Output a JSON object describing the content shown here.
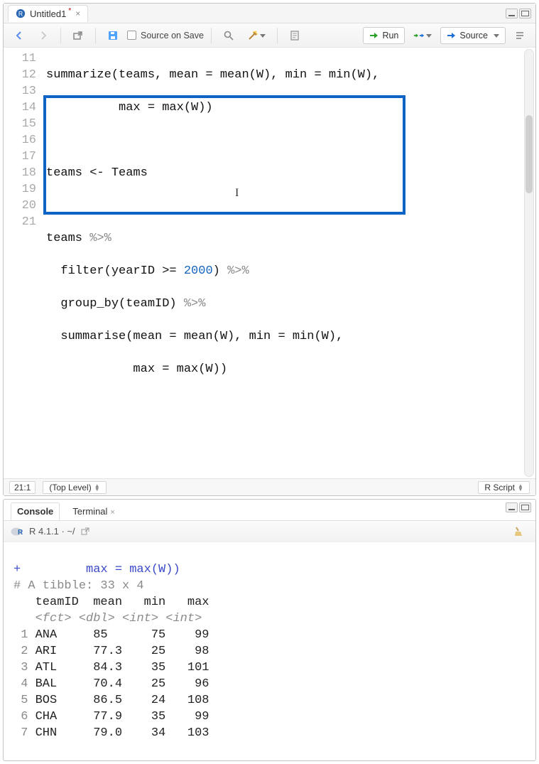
{
  "editor_tab": {
    "icon": "r-doc-icon",
    "title": "Untitled1",
    "dirty": "*"
  },
  "toolbar": {
    "source_on_save": "Source on Save",
    "run": "Run",
    "source": "Source"
  },
  "gutter": [
    "11",
    "12",
    "13",
    "14",
    "15",
    "16",
    "17",
    "18",
    "19",
    "20",
    "21"
  ],
  "code": {
    "l11a": "summarize(teams, mean = mean(W), min = min(W),",
    "l12a": "          max = max(W))",
    "l13a": "",
    "l14a": "teams <- Teams",
    "l15a": "",
    "l16a": "teams ",
    "l16b": "%>%",
    "l17a": "  filter(yearID >= ",
    "l17n": "2000",
    "l17b": ") ",
    "l17c": "%>%",
    "l18a": "  group_by(teamID) ",
    "l18b": "%>%",
    "l19a": "  summarise(mean = mean(W), min = min(W),",
    "l20a": "            max = max(W))",
    "l21a": ""
  },
  "status": {
    "pos": "21:1",
    "scope": "(Top Level)",
    "lang": "R Script"
  },
  "console": {
    "tabs": {
      "console": "Console",
      "terminal": "Terminal"
    },
    "rver": "R 4.1.1 · ~/",
    "plus": "+",
    "cont": "         max = max(W))",
    "tibble": "# A tibble: 33 x 4",
    "hdr_teamID": "   teamID",
    "hdr_mean": "  mean",
    "hdr_min": "   min",
    "hdr_max": "   max",
    "typ_fct": "   <fct>",
    "typ_dbl": " <dbl>",
    "typ_int1": " <int>",
    "typ_int2": " <int>",
    "rows": [
      {
        "n": "1",
        "team": "ANA",
        "mean": "85  ",
        "min": "75",
        "max": " 99"
      },
      {
        "n": "2",
        "team": "ARI",
        "mean": "77.3",
        "min": "25",
        "max": " 98"
      },
      {
        "n": "3",
        "team": "ATL",
        "mean": "84.3",
        "min": "35",
        "max": "101"
      },
      {
        "n": "4",
        "team": "BAL",
        "mean": "70.4",
        "min": "25",
        "max": " 96"
      },
      {
        "n": "5",
        "team": "BOS",
        "mean": "86.5",
        "min": "24",
        "max": "108"
      },
      {
        "n": "6",
        "team": "CHA",
        "mean": "77.9",
        "min": "35",
        "max": " 99"
      },
      {
        "n": "7",
        "team": "CHN",
        "mean": "79.0",
        "min": "34",
        "max": "103"
      }
    ]
  }
}
